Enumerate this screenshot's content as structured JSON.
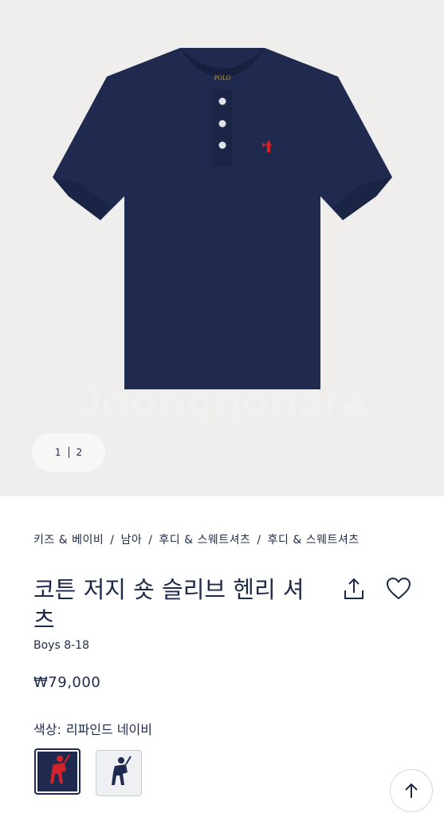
{
  "hero": {
    "watermark": "Joonggonara",
    "pager": {
      "current": "1",
      "total": "2"
    },
    "label_text": "POLO"
  },
  "breadcrumb": {
    "items": [
      "키즈 & 베이비",
      "남아",
      "후디 & 스웨트셔츠",
      "후디 & 스웨트셔츠"
    ]
  },
  "product": {
    "title": "코튼 저지 숏 슬리브 헨리 셔츠",
    "subtitle": "Boys 8-18",
    "price": "₩79,000",
    "color_label": "색상:",
    "color_value": "리파인드 네이비"
  },
  "icons": {
    "share": "share-icon",
    "wishlist": "heart-icon",
    "back_to_top": "arrow-up-icon"
  },
  "colors": {
    "navy": "#1f2a4e",
    "logo_red": "#d3232a",
    "hero_bg": "#efeeed"
  }
}
